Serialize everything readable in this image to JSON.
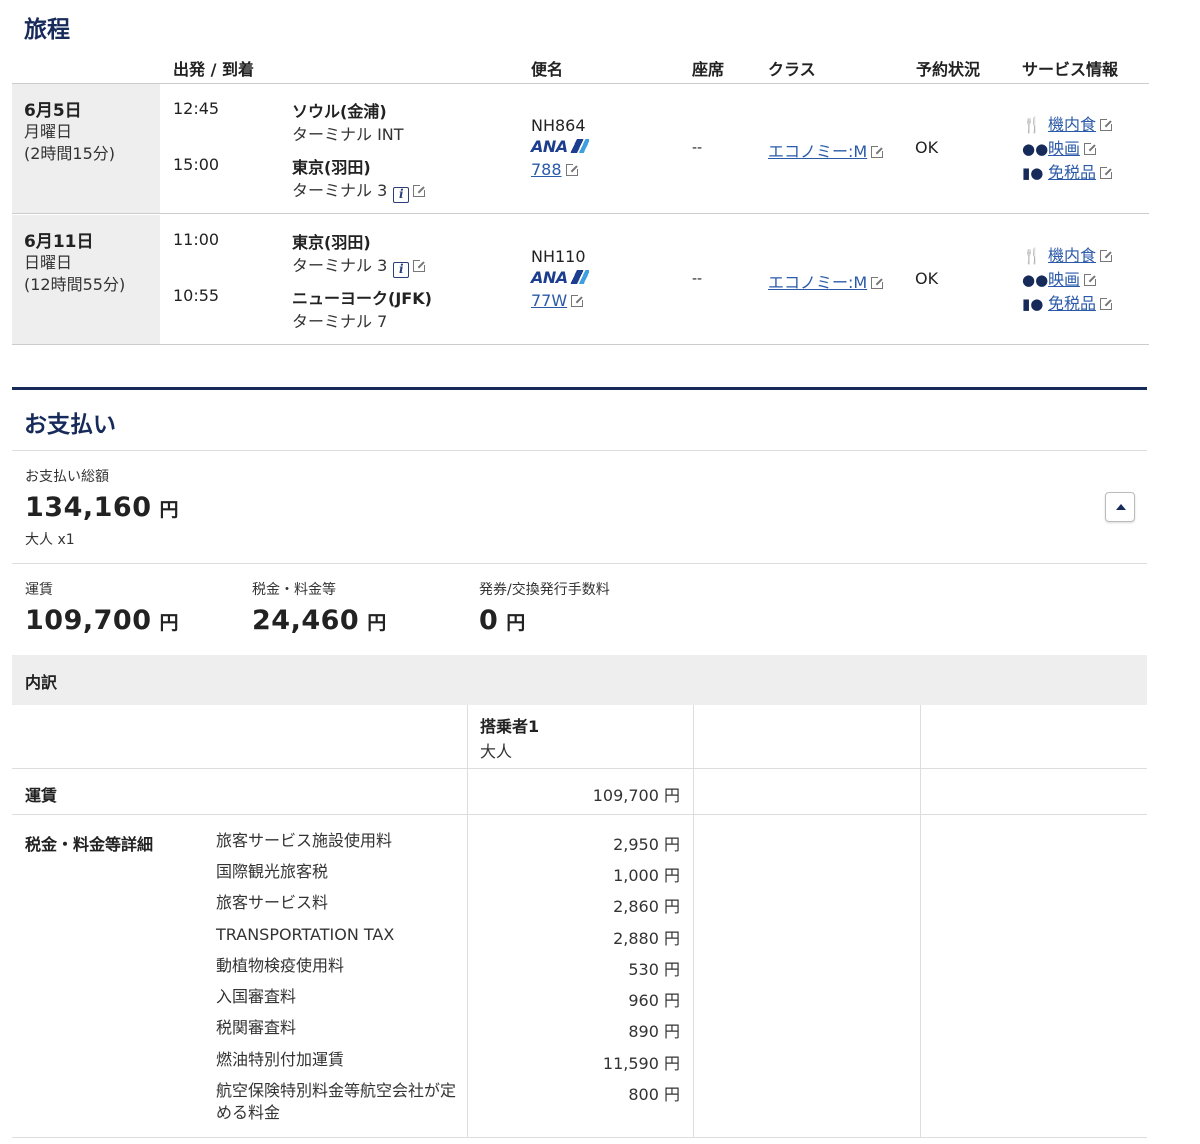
{
  "itinerary": {
    "title": "旅程",
    "headers": {
      "dep_arr": "出発 / 到着",
      "flight": "便名",
      "seat": "座席",
      "class": "クラス",
      "status": "予約状況",
      "service": "サービス情報"
    },
    "segments": [
      {
        "date": "6月5日",
        "weekday": "月曜日",
        "duration": "(2時間15分)",
        "dep_time": "12:45",
        "dep_airport": "ソウル(金浦)",
        "dep_terminal": "ターミナル INT",
        "arr_time": "15:00",
        "arr_airport": "東京(羽田)",
        "arr_terminal": "ターミナル 3",
        "flight_no": "NH864",
        "airline": "ANA",
        "aircraft": "788",
        "seat": "--",
        "class": "エコノミー:M",
        "status": "OK",
        "services": [
          "機内食",
          "映画",
          "免税品"
        ]
      },
      {
        "date": "6月11日",
        "weekday": "日曜日",
        "duration": "(12時間55分)",
        "dep_time": "11:00",
        "dep_airport": "東京(羽田)",
        "dep_terminal": "ターミナル 3",
        "arr_time": "10:55",
        "arr_airport": "ニューヨーク(JFK)",
        "arr_terminal": "ターミナル 7",
        "flight_no": "NH110",
        "airline": "ANA",
        "aircraft": "77W",
        "seat": "--",
        "class": "エコノミー:M",
        "status": "OK",
        "services": [
          "機内食",
          "映画",
          "免税品"
        ]
      }
    ]
  },
  "payment": {
    "title": "お支払い",
    "total_label": "お支払い総額",
    "total_amount": "134,160",
    "yen": "円",
    "pax_summary": "大人 x1",
    "fare_label": "運賃",
    "fare_amount": "109,700",
    "tax_label": "税金・料金等",
    "tax_amount": "24,460",
    "fee_label": "発券/交換発行手数料",
    "fee_amount": "0"
  },
  "breakdown": {
    "title": "内訳",
    "passenger_label": "搭乗者1",
    "passenger_type": "大人",
    "fare_row_label": "運賃",
    "fare_row_value": "109,700 円",
    "tax_row_label": "税金・料金等詳細",
    "taxes": [
      {
        "name": "旅客サービス施設使用料",
        "value": "2,950 円"
      },
      {
        "name": "国際観光旅客税",
        "value": "1,000 円"
      },
      {
        "name": "旅客サービス料",
        "value": "2,860 円"
      },
      {
        "name": "TRANSPORTATION TAX",
        "value": "2,880 円"
      },
      {
        "name": "動植物検疫使用料",
        "value": "530 円"
      },
      {
        "name": "入国審査料",
        "value": "960 円"
      },
      {
        "name": "税関審査料",
        "value": "890 円"
      },
      {
        "name": "燃油特別付加運賃",
        "value": "11,590 円"
      },
      {
        "name": "航空保険特別料金等航空会社が定める料金",
        "value": "800 円"
      }
    ]
  },
  "icons": {
    "meal": "fork-knife-icon",
    "movie": "film-camera-icon",
    "dutyfree": "bottle-icon",
    "info": "info-icon",
    "external": "external-link-icon"
  },
  "colors": {
    "navy": "#172b5a",
    "link": "#2b5aa8",
    "date_bg": "#eeeeee"
  }
}
